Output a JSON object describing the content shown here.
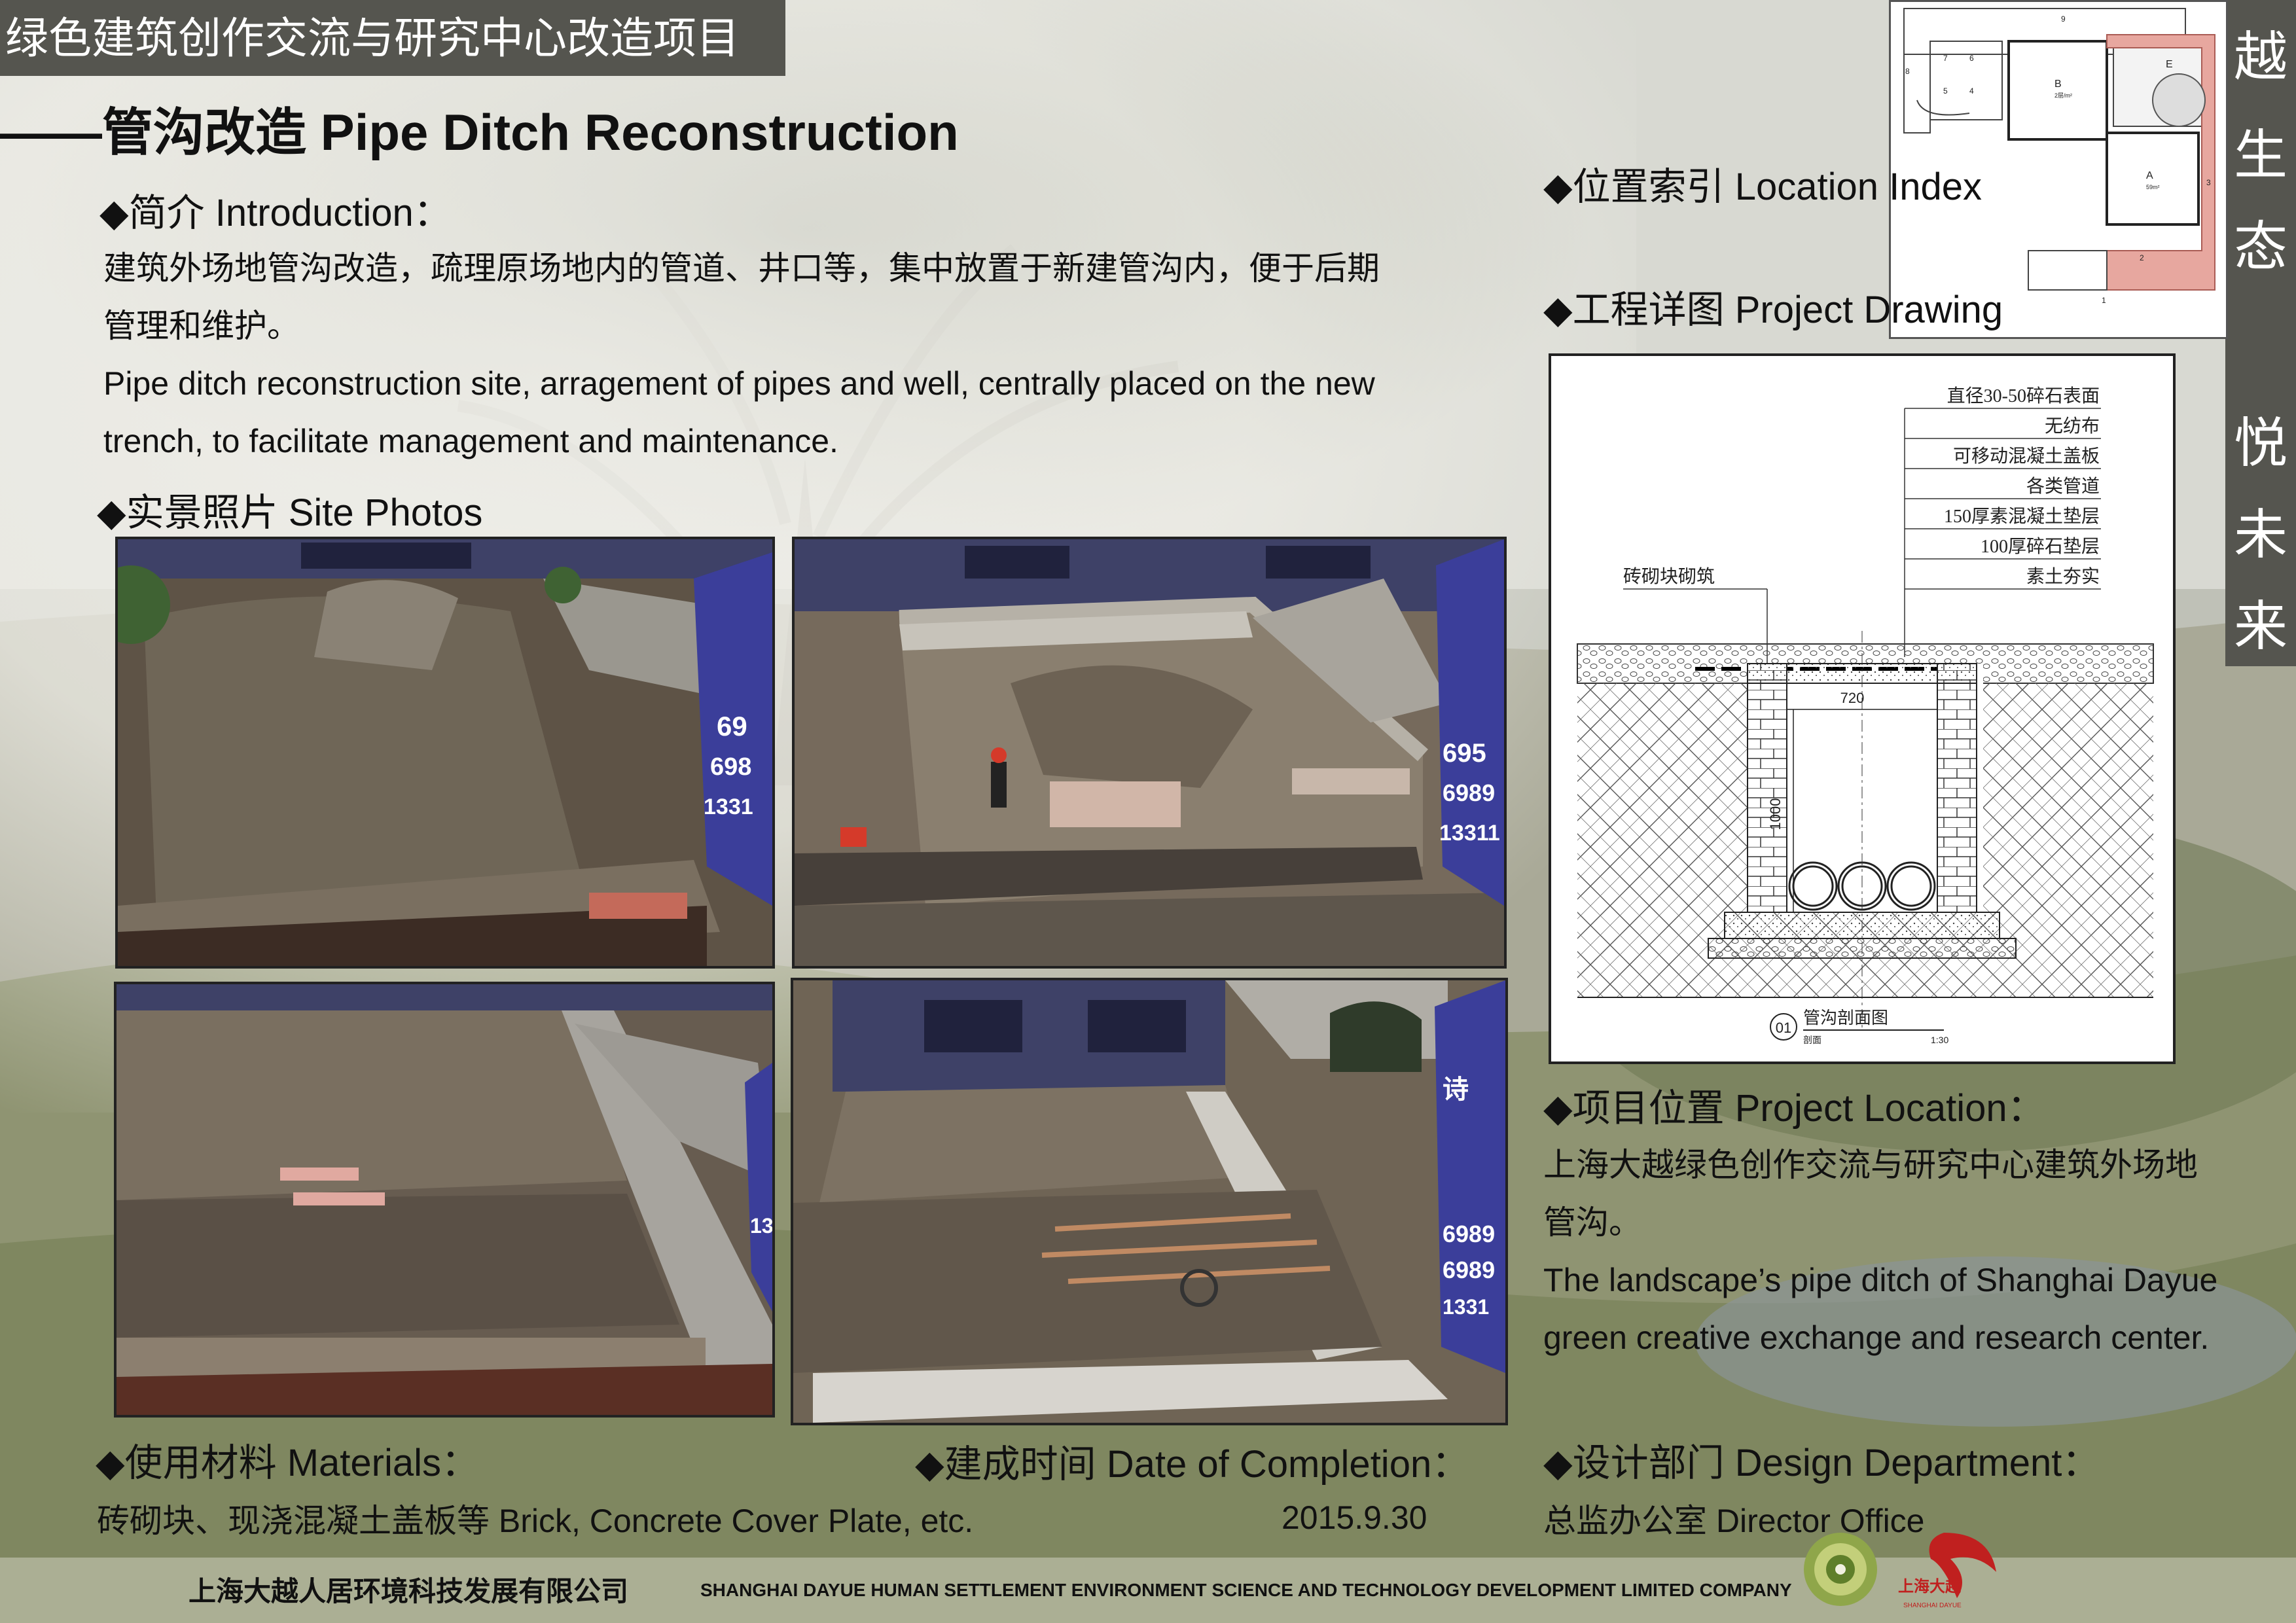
{
  "header": {
    "project_title": "绿色建筑创作交流与研究中心改造项目",
    "section_title": "——管沟改造 Pipe Ditch Reconstruction"
  },
  "side_band": {
    "chars": [
      "越",
      "生",
      "态",
      "悦",
      "未",
      "来"
    ]
  },
  "introduction": {
    "heading": "◆简介 Introduction：",
    "text_cn_1": "建筑外场地管沟改造，疏理原场地内的管道、井口等，集中放置于新建管沟内，便于后期",
    "text_cn_2": "管理和维护。",
    "text_en_1": "Pipe ditch reconstruction site, arragement of pipes and well, centrally placed on the new",
    "text_en_2": "trench, to facilitate management and maintenance."
  },
  "site_photos": {
    "heading": "◆实景照片 Site Photos",
    "sign_texts": {
      "p1": [
        "69",
        "698",
        "1331"
      ],
      "p2": [
        "695",
        "6989",
        "13311"
      ],
      "p3": [
        "13"
      ],
      "p4": [
        "诗",
        "6989",
        "6989",
        "1331"
      ]
    }
  },
  "location_index": {
    "heading": "◆位置索引 Location Index"
  },
  "mini_plan": {
    "room_labels": [
      "B",
      "A",
      "E",
      "9",
      "8",
      "7",
      "6",
      "5",
      "4",
      "3",
      "2",
      "1"
    ],
    "room_subtitles": [
      "2层/m²",
      "59m²"
    ]
  },
  "project_drawing": {
    "heading": "◆工程详图 Project  Drawing",
    "layers": [
      "直径30-50碎石表面",
      "无纺布",
      "可移动混凝土盖板",
      "各类管道",
      "150厚素混凝土垫层",
      "100厚碎石垫层",
      "素土夯实"
    ],
    "left_label": "砖砌块砌筑",
    "dim_width": "720",
    "dim_height": "1000",
    "caption_num": "01",
    "caption_title": "管沟剖面图",
    "caption_sub": "剖面",
    "caption_scale": "1:30"
  },
  "project_location": {
    "heading": "◆项目位置 Project Location：",
    "text_cn_1": "上海大越绿色创作交流与研究中心建筑外场地",
    "text_cn_2": "管沟。",
    "text_en_1": "The landscape’s pipe ditch of Shanghai Dayue",
    "text_en_2": "green creative exchange and research center."
  },
  "materials": {
    "heading": "◆使用材料 Materials：",
    "text": "砖砌块、现浇混凝土盖板等 Brick, Concrete Cover Plate, etc."
  },
  "completion": {
    "heading": "◆建成时间 Date of Completion：",
    "date": "2015.9.30"
  },
  "design_department": {
    "heading": "◆设计部门 Design Department：",
    "text": "总监办公室 Director Office"
  },
  "footer": {
    "company_cn": "上海大越人居环境科技发展有限公司",
    "company_en": "SHANGHAI DAYUE HUMAN SETTLEMENT ENVIRONMENT SCIENCE AND TECHNOLOGY DEVELOPMENT LIMITED COMPANY",
    "logo_cn": "上海大越",
    "logo_en": "SHANGHAI DAYUE"
  },
  "colors": {
    "band": "#55554f",
    "brick_red": "#c9605a",
    "sign_blue": "#3b3e9a",
    "dirt": "#6e6254"
  }
}
